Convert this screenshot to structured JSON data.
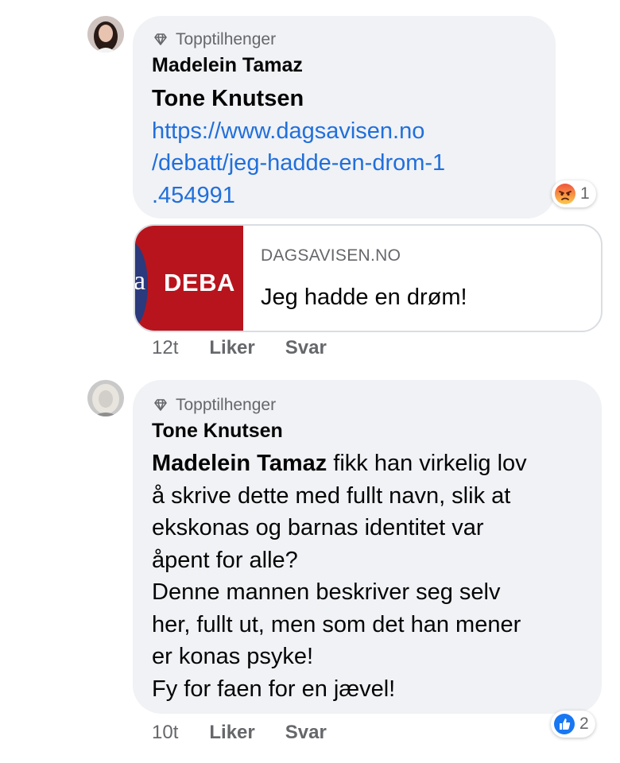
{
  "comments": [
    {
      "badge": "Topptilhenger",
      "author": "Madelein Tamaz",
      "mention": "Tone Knutsen",
      "link_lines": [
        "https://www.dagsavisen.no",
        "/debatt/jeg-hadde-en-drom-1",
        ".454991"
      ],
      "reaction": {
        "icon": "angry-emoji-icon",
        "count": "1"
      },
      "preview": {
        "domain": "DAGSAVISEN.NO",
        "title": "Jeg hadde en drøm!",
        "thumb_logo": "a",
        "thumb_text": "DEBA"
      },
      "time": "12t",
      "like": "Liker",
      "reply": "Svar"
    },
    {
      "badge": "Topptilhenger",
      "author": "Tone Knutsen",
      "mention": "Madelein Tamaz",
      "first_line_rest": " fikk han virkelig lov",
      "lines": [
        "å skrive dette med fullt navn, slik at",
        "ekskonas og barnas identitet var",
        "åpent for alle?",
        "Denne mannen beskriver seg selv",
        "her, fullt ut, men som det han mener",
        "er konas psyke!",
        "Fy for faen for en jævel!"
      ],
      "reaction": {
        "icon": "like-icon",
        "count": "2"
      },
      "time": "10t",
      "like": "Liker",
      "reply": "Svar"
    }
  ],
  "colors": {
    "bubble": "#f0f2f5",
    "link": "#216fdb",
    "meta": "#65676b",
    "angry": "#f0543c",
    "like": "#1877f2"
  }
}
